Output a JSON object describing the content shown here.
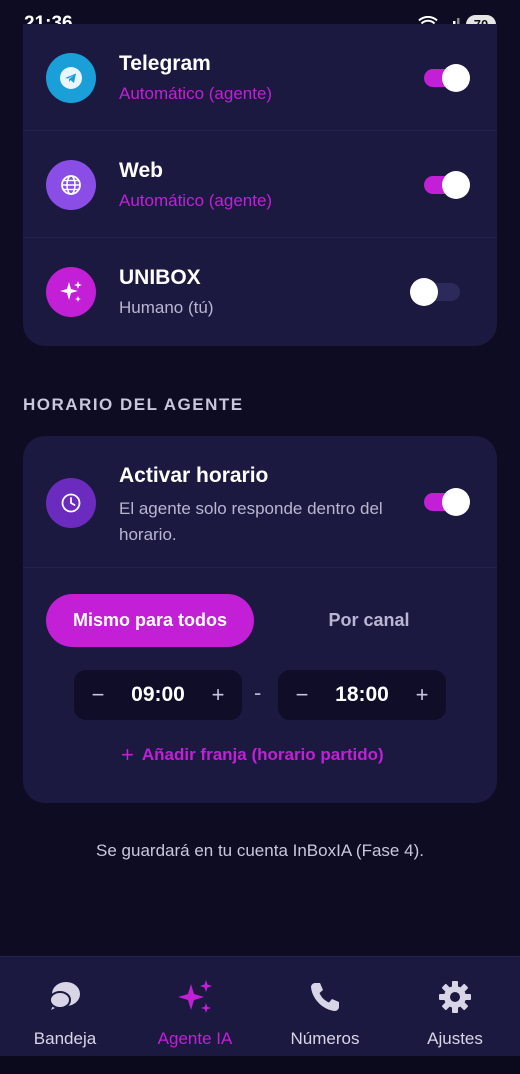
{
  "status_bar": {
    "time": "21:36",
    "battery": "70"
  },
  "channels": [
    {
      "name": "Telegram",
      "mode": "Automático (agente)",
      "icon": "telegram-icon",
      "icon_color": "#1a9fd8",
      "enabled": true
    },
    {
      "name": "Web",
      "mode": "Automático (agente)",
      "icon": "globe-icon",
      "icon_color": "#8a4de6",
      "enabled": true
    },
    {
      "name": "UNIBOX",
      "mode": "Humano (tú)",
      "icon": "sparkles-icon",
      "icon_color": "#c21fd6",
      "enabled": false
    }
  ],
  "schedule": {
    "section_title": "HORARIO DEL AGENTE",
    "toggle_title": "Activar horario",
    "toggle_description": "El agente solo responde dentro del horario.",
    "enabled": true,
    "tabs": {
      "same": "Mismo para todos",
      "per_channel": "Por canal",
      "selected": "same"
    },
    "start": "09:00",
    "end": "18:00",
    "separator": "-",
    "add_slot": "Añadir franja (horario partido)"
  },
  "footnote": "Se guardará en tu cuenta InBoxIA (Fase 4).",
  "nav": {
    "items": [
      {
        "label": "Bandeja",
        "icon": "chat-bubbles-icon"
      },
      {
        "label": "Agente IA",
        "icon": "sparkles-icon"
      },
      {
        "label": "Números",
        "icon": "phone-icon"
      },
      {
        "label": "Ajustes",
        "icon": "gear-icon"
      }
    ],
    "active": 1
  },
  "colors": {
    "accent": "#c21fd6",
    "background": "#0e0c22",
    "card": "#1b1940"
  }
}
